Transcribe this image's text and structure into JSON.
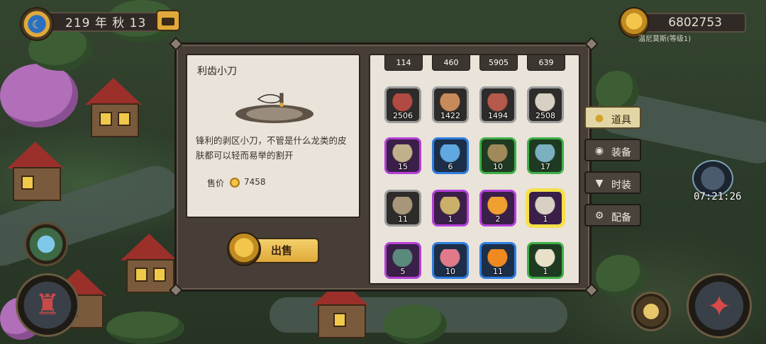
{
  "hud": {
    "date": "219 年 秋 13",
    "gold": "6802753",
    "npc_label": "温尼莫斯(等级1)",
    "timer": "07:21:26"
  },
  "detail": {
    "item_name": "利齿小刀",
    "description": "锋利的剥区小刀，不管是什么龙类的皮肤都可以轻而易举的割开",
    "price_label": "售价",
    "price_value": "7458",
    "sell_label": "出售"
  },
  "inventory": {
    "top_counts": [
      "114",
      "460",
      "5905",
      "639"
    ],
    "rows": [
      [
        {
          "qty": "2506",
          "rarity": "gray",
          "icon": "raw-meat-icon",
          "color": "#b14a42"
        },
        {
          "qty": "1422",
          "rarity": "gray",
          "icon": "hide-icon",
          "color": "#c98a5a"
        },
        {
          "qty": "1494",
          "rarity": "gray",
          "icon": "ham-icon",
          "color": "#b55a4a"
        },
        {
          "qty": "2508",
          "rarity": "gray",
          "icon": "fang-icon",
          "color": "#d8d0c4"
        }
      ],
      [
        {
          "qty": "15",
          "rarity": "purple",
          "icon": "scroll-icon",
          "color": "#c2b08a"
        },
        {
          "qty": "6",
          "rarity": "blue",
          "icon": "claw-icon",
          "color": "#5fa8e0"
        },
        {
          "qty": "10",
          "rarity": "green",
          "icon": "wings-icon",
          "color": "#a08a5a"
        },
        {
          "qty": "17",
          "rarity": "green",
          "icon": "scale-icon",
          "color": "#7ab0c0"
        }
      ],
      [
        {
          "qty": "11",
          "rarity": "gray",
          "icon": "potion-bag-icon",
          "color": "#a8967a"
        },
        {
          "qty": "1",
          "rarity": "purple",
          "icon": "horn-icon",
          "color": "#c8b06a"
        },
        {
          "qty": "2",
          "rarity": "purple",
          "icon": "flame-crystal-icon",
          "color": "#f0a030"
        },
        {
          "qty": "1",
          "rarity": "purple",
          "icon": "knife-icon",
          "color": "#d8d0c4",
          "selected": true
        }
      ],
      [
        {
          "qty": "5",
          "rarity": "purple",
          "icon": "gem-icon",
          "color": "#5a8a7a"
        },
        {
          "qty": "10",
          "rarity": "blue",
          "icon": "pink-leaf-icon",
          "color": "#e07a8a"
        },
        {
          "qty": "11",
          "rarity": "blue",
          "icon": "fire-icon",
          "color": "#f08a20"
        },
        {
          "qty": "1",
          "rarity": "green",
          "icon": "bone-icon",
          "color": "#e8e0c8"
        }
      ]
    ]
  },
  "tabs": [
    {
      "label": "道具",
      "icon": "pouch-icon",
      "active": true
    },
    {
      "label": "装备",
      "icon": "helmet-icon",
      "active": false
    },
    {
      "label": "时装",
      "icon": "shirt-icon",
      "active": false
    },
    {
      "label": "配备",
      "icon": "gear-icon",
      "active": false
    }
  ],
  "colors": {
    "rarity_gray": "#9c9c9c",
    "rarity_purple": "#b640d8",
    "rarity_blue": "#2f7fe0",
    "rarity_green": "#3fb048",
    "selected_outline": "#f5e04a",
    "gold": "#e0a93a"
  }
}
